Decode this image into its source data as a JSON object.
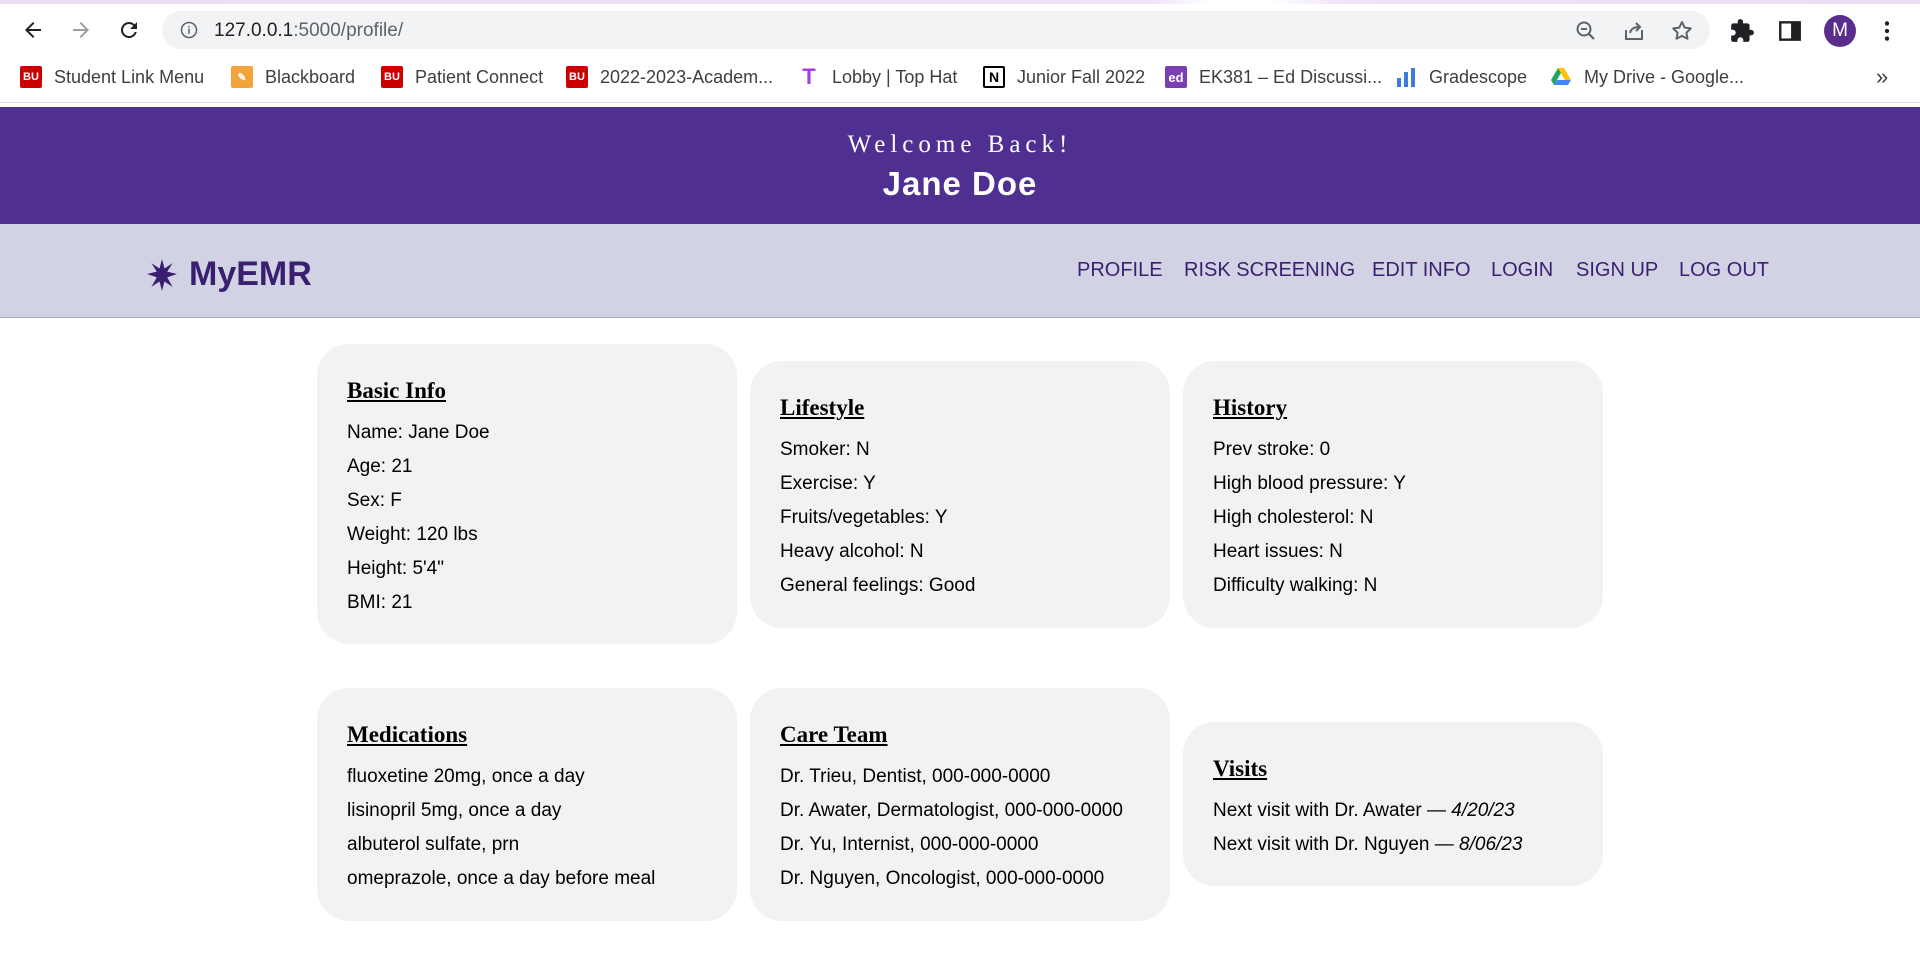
{
  "browser": {
    "url_host": "127.0.0.1",
    "url_path": ":5000/profile/",
    "profile_initial": "M",
    "bookmarks": [
      {
        "label": "Student Link Menu",
        "icon": "bu-icon",
        "color": "#cc0000"
      },
      {
        "label": "Blackboard",
        "icon": "blackboard-icon",
        "color": "#f2a33a"
      },
      {
        "label": "Patient Connect",
        "icon": "bu-icon",
        "color": "#cc0000"
      },
      {
        "label": "2022-2023-Academ...",
        "icon": "bu-icon",
        "color": "#cc0000"
      },
      {
        "label": "Lobby | Top Hat",
        "icon": "tophat-icon",
        "color": "#a63fe0"
      },
      {
        "label": "Junior Fall 2022",
        "icon": "notion-icon",
        "color": "#000000"
      },
      {
        "label": "EK381 – Ed Discussi...",
        "icon": "ed-icon",
        "color": "#7b3fb5"
      },
      {
        "label": "Gradescope",
        "icon": "gradescope-icon",
        "color": "#3c7be0"
      },
      {
        "label": "My Drive - Google...",
        "icon": "google-drive-icon",
        "color": "#1fa463"
      }
    ],
    "bookmarks_overflow": "»"
  },
  "banner": {
    "welcome": "Welcome Back!",
    "name": "Jane Doe",
    "color": "#4f2f8f"
  },
  "navbar": {
    "brand": "MyEMR",
    "links": [
      "PROFILE",
      "RISK SCREENING",
      "EDIT INFO",
      "LOGIN",
      "SIGN UP",
      "LOG OUT"
    ],
    "color": "#d1d3e4"
  },
  "cards": {
    "basic_info": {
      "title": "Basic Info",
      "lines": [
        "Name: Jane Doe",
        "Age: 21",
        "Sex: F",
        "Weight: 120 lbs",
        "Height: 5'4\"",
        "BMI: 21"
      ]
    },
    "lifestyle": {
      "title": "Lifestyle",
      "lines": [
        "Smoker: N",
        "Exercise: Y",
        "Fruits/vegetables: Y",
        "Heavy alcohol: N",
        "General feelings: Good"
      ]
    },
    "history": {
      "title": "History",
      "lines": [
        "Prev stroke: 0",
        "High blood pressure: Y",
        "High cholesterol: N",
        "Heart issues: N",
        "Difficulty walking: N"
      ]
    },
    "medications": {
      "title": "Medications",
      "lines": [
        "fluoxetine 20mg, once a day",
        "lisinopril 5mg, once a day",
        "albuterol sulfate, prn",
        "omeprazole, once a day before meal"
      ]
    },
    "care_team": {
      "title": "Care Team",
      "lines": [
        "Dr. Trieu, Dentist, 000-000-0000",
        "Dr. Awater, Dermatologist, 000-000-0000",
        "Dr. Yu, Internist, 000-000-0000",
        "Dr. Nguyen, Oncologist, 000-000-0000"
      ]
    },
    "visits": {
      "title": "Visits",
      "items": [
        {
          "text": "Next visit with Dr. Awater — ",
          "date": "4/20/23"
        },
        {
          "text": "Next visit with Dr. Nguyen — ",
          "date": "8/06/23"
        }
      ]
    }
  }
}
